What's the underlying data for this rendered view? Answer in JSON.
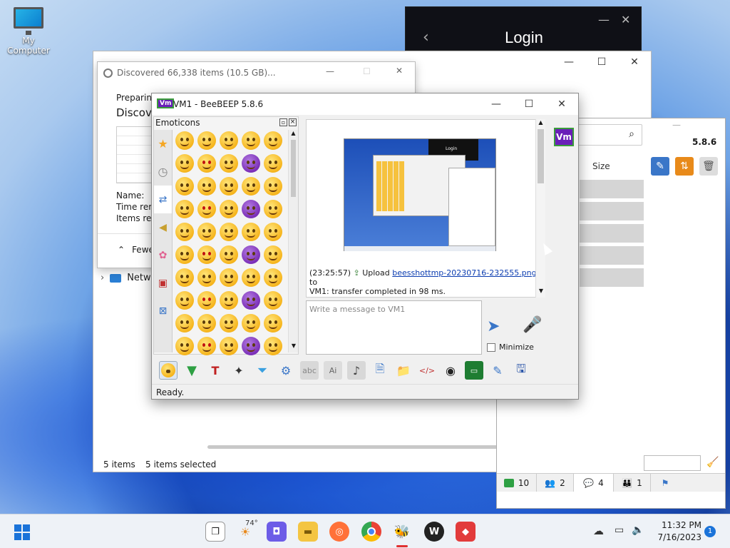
{
  "desktop": {
    "icon_label": "My Computer"
  },
  "login": {
    "title": "Login",
    "back": "‹",
    "minimize": "—",
    "close": "✕"
  },
  "explorer": {
    "status_items": "5 items",
    "status_selected": "5 items selected",
    "size_header": "Size",
    "nav_network": "Netw"
  },
  "copy_dialog": {
    "title": "Discovered 66,338 items (10.5 GB)...",
    "preparing": "Preparing",
    "heading": "Discove",
    "name_label": "Name:",
    "time_label": "Time rem",
    "items_label": "Items rem",
    "fewer": "Fewe"
  },
  "bb_main": {
    "version": "5.8.6",
    "tabs": [
      {
        "icon": "chat-icon-green",
        "count": "10"
      },
      {
        "icon": "users-icon",
        "count": "2"
      },
      {
        "icon": "messages-icon",
        "count": "4"
      },
      {
        "icon": "group-icon",
        "count": "1"
      }
    ]
  },
  "chat": {
    "title": "VM1 - BeeBEEP 5.8.6",
    "app_badge": "Vm",
    "emoticons_panel_title": "Emoticons",
    "log_time": "(23:25:57)",
    "log_upload": "Upload",
    "log_file": "beesshottmp-20230716-232555.png",
    "log_to": "to",
    "log_rest": "VM1: transfer completed in 98 ms.",
    "message_placeholder": "Write a message to VM1",
    "minimize_label": "Minimize",
    "status": "Ready.",
    "user_badge": "Vm"
  },
  "thumbnail": {
    "login_text": "Login"
  },
  "taskbar": {
    "weather": "74°",
    "time": "11:32 PM",
    "date": "7/16/2023",
    "notifications": "1"
  }
}
